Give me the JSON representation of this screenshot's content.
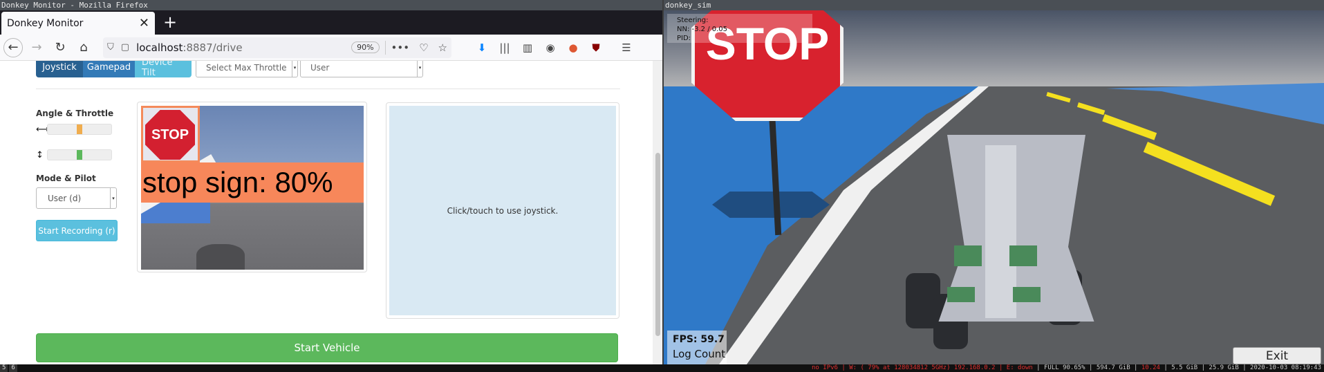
{
  "firefox": {
    "window_title": "Donkey Monitor - Mozilla Firefox",
    "tab_title": "Donkey Monitor",
    "url_host": "localhost",
    "url_path": ":8887/drive",
    "zoom": "90%"
  },
  "controls": {
    "mode_buttons": [
      "Joystick",
      "Gamepad",
      "Device Tilt"
    ],
    "max_throttle_select": "Select Max Throttle",
    "user_select": "User",
    "angle_throttle_label": "Angle & Throttle",
    "angle_value": 0.5,
    "throttle_value": 0.5,
    "mode_pilot_label": "Mode & Pilot",
    "mode_select_value": "User (d)",
    "start_recording": "Start Recording (r)"
  },
  "camera": {
    "stop_text": "STOP",
    "detection_label": "stop sign: 80%"
  },
  "joystick": {
    "hint": "Click/touch to use joystick."
  },
  "start_vehicle": "Start Vehicle",
  "sim": {
    "window_title": "donkey_sim",
    "stop_text": "STOP",
    "hud_steering": "Steering:",
    "hud_nn": "NN: -3.2 / 0.05",
    "hud_pid": "PID:",
    "fps": "FPS: 59.7",
    "log_count": "Log Count",
    "exit": "Exit"
  },
  "statusbar": {
    "workspaces": [
      "5",
      "6"
    ],
    "net": "no IPv6 | W: ( 79% at 128034812 5GHz) 192.168.0.2 | E: down",
    "disk": "FULL 90.65% | 594.7 GiB",
    "load": "10.24",
    "mem": "5.5 GiB | 25.9 GiB",
    "datetime": "2020-10-03 08:19:43"
  },
  "colors": {
    "primary_dark": "#286090",
    "primary": "#337ab7",
    "info": "#5bc0de",
    "success": "#5cb85c",
    "angle_fill": "#f0ad4e",
    "throttle_fill": "#5cb85c"
  }
}
